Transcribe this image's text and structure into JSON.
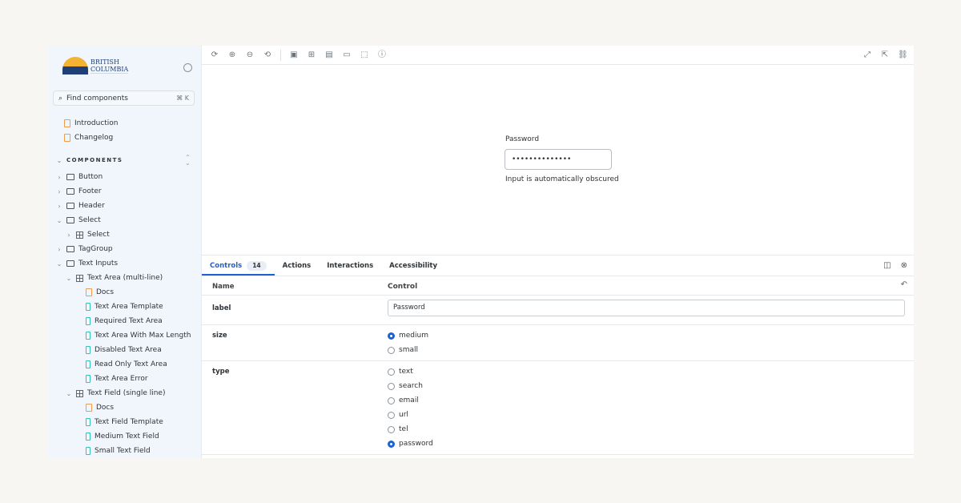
{
  "sidebar": {
    "logo_text": "BRITISH COLUMBIA",
    "search": {
      "placeholder": "Find components",
      "shortcut": "⌘ K"
    },
    "docs": [
      {
        "label": "Introduction"
      },
      {
        "label": "Changelog"
      }
    ],
    "section": "COMPONENTS",
    "tree": [
      {
        "label": "Button",
        "type": "folder",
        "level": 0,
        "expanded": false
      },
      {
        "label": "Footer",
        "type": "folder",
        "level": 0,
        "expanded": false
      },
      {
        "label": "Header",
        "type": "folder",
        "level": 0,
        "expanded": false
      },
      {
        "label": "Select",
        "type": "folder",
        "level": 0,
        "expanded": true
      },
      {
        "label": "Select",
        "type": "component",
        "level": 1,
        "expanded": false
      },
      {
        "label": "TagGroup",
        "type": "folder",
        "level": 0,
        "expanded": false
      },
      {
        "label": "Text Inputs",
        "type": "folder",
        "level": 0,
        "expanded": true
      },
      {
        "label": "Text Area (multi-line)",
        "type": "component",
        "level": 1,
        "expanded": true
      },
      {
        "label": "Docs",
        "type": "doc",
        "level": 2
      },
      {
        "label": "Text Area Template",
        "type": "story",
        "level": 2
      },
      {
        "label": "Required Text Area",
        "type": "story",
        "level": 2
      },
      {
        "label": "Text Area With Max Length",
        "type": "story",
        "level": 2
      },
      {
        "label": "Disabled Text Area",
        "type": "story",
        "level": 2
      },
      {
        "label": "Read Only Text Area",
        "type": "story",
        "level": 2
      },
      {
        "label": "Text Area Error",
        "type": "story",
        "level": 2
      },
      {
        "label": "Text Field (single line)",
        "type": "component",
        "level": 1,
        "expanded": true
      },
      {
        "label": "Docs",
        "type": "doc",
        "level": 2
      },
      {
        "label": "Text Field Template",
        "type": "story",
        "level": 2
      },
      {
        "label": "Medium Text Field",
        "type": "story",
        "level": 2
      },
      {
        "label": "Small Text Field",
        "type": "story",
        "level": 2
      }
    ]
  },
  "toolbar": {
    "icons": [
      "reload-icon",
      "zoom-in-icon",
      "zoom-out-icon",
      "zoom-reset-icon",
      "background-icon",
      "grid-icon",
      "viewport-icon",
      "measure-icon",
      "outline-icon",
      "accessibility-icon"
    ],
    "right_icons": [
      "fullscreen-icon",
      "open-new-tab-icon",
      "copy-link-icon"
    ]
  },
  "preview": {
    "label": "Password",
    "value": "••••••••••••••",
    "help": "Input is automatically obscured"
  },
  "panel": {
    "tabs": [
      {
        "label": "Controls",
        "badge": "14"
      },
      {
        "label": "Actions"
      },
      {
        "label": "Interactions"
      },
      {
        "label": "Accessibility"
      }
    ],
    "headers": {
      "name": "Name",
      "control": "Control"
    },
    "rows": {
      "label": {
        "name": "label",
        "value": "Password"
      },
      "size": {
        "name": "size",
        "options": [
          "medium",
          "small"
        ],
        "selected": "medium"
      },
      "type": {
        "name": "type",
        "options": [
          "text",
          "search",
          "email",
          "url",
          "tel",
          "password"
        ],
        "selected": "password"
      }
    }
  },
  "colors": {
    "accent": "#1e62d0",
    "sidebar_bg": "#f0f6fc",
    "page_bg": "#f7f6f3"
  }
}
